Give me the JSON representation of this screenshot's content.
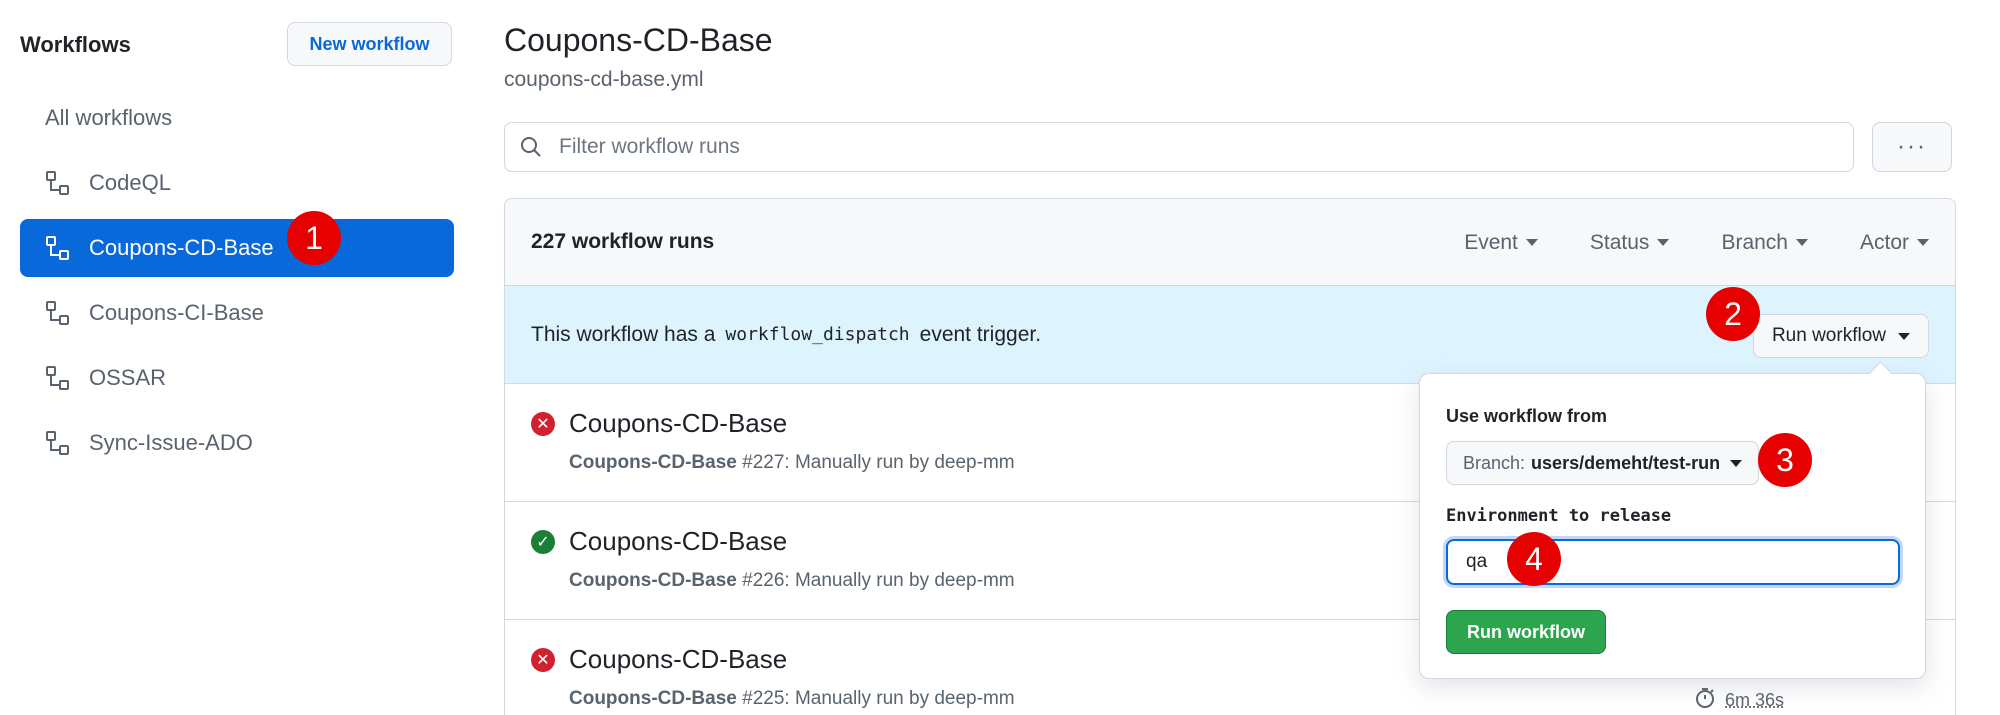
{
  "sidebar": {
    "title": "Workflows",
    "new_button": "New workflow",
    "items": [
      {
        "label": "All workflows"
      },
      {
        "label": "CodeQL"
      },
      {
        "label": "Coupons-CD-Base"
      },
      {
        "label": "Coupons-CI-Base"
      },
      {
        "label": "OSSAR"
      },
      {
        "label": "Sync-Issue-ADO"
      }
    ]
  },
  "header": {
    "title": "Coupons-CD-Base",
    "file": "coupons-cd-base.yml"
  },
  "filter": {
    "placeholder": "Filter workflow runs",
    "more": "···"
  },
  "runs": {
    "count": "227 workflow runs",
    "filters": [
      "Event",
      "Status",
      "Branch",
      "Actor"
    ],
    "dispatch_text_before": "This workflow has a",
    "dispatch_code": "workflow_dispatch",
    "dispatch_text_after": "event trigger.",
    "run_workflow_button": "Run workflow",
    "rows": [
      {
        "status": "failure",
        "title": "Coupons-CD-Base",
        "meta_name": "Coupons-CD-Base",
        "meta_rest": "#227: Manually run by deep-mm"
      },
      {
        "status": "success",
        "title": "Coupons-CD-Base",
        "meta_name": "Coupons-CD-Base",
        "meta_rest": "#226: Manually run by deep-mm"
      },
      {
        "status": "failure",
        "title": "Coupons-CD-Base",
        "meta_name": "Coupons-CD-Base",
        "meta_rest": "#225: Manually run by deep-mm",
        "duration": "6m 36s"
      }
    ]
  },
  "popover": {
    "use_from_label": "Use workflow from",
    "branch_prefix": "Branch:",
    "branch_value": "users/demeht/test-run",
    "env_label": "Environment to release",
    "env_value": "qa",
    "run_button": "Run workflow"
  },
  "badges": [
    "1",
    "2",
    "3",
    "4"
  ],
  "colors": {
    "accent": "#0969da",
    "badge": "#e60000",
    "success": "#1a7f37",
    "failure": "#cf222e",
    "run_button": "#2da44e"
  }
}
